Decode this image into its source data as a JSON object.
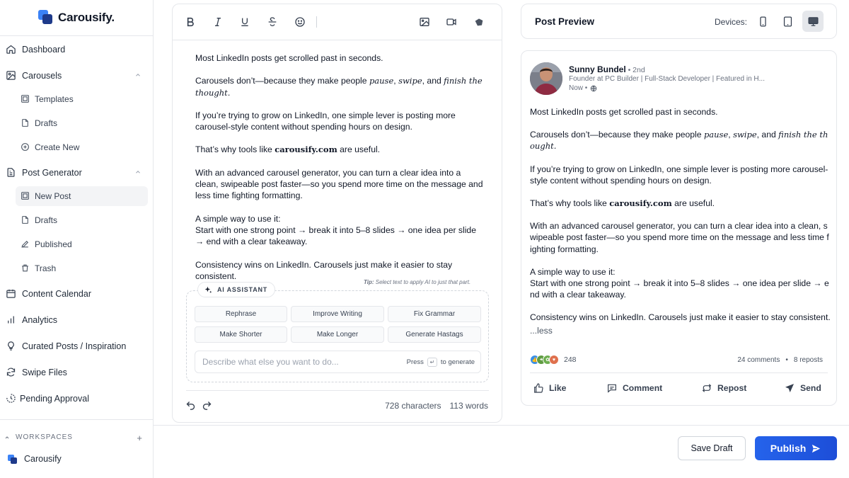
{
  "brand": {
    "name": "Carousify."
  },
  "nav": {
    "dashboard": "Dashboard",
    "carousels": "Carousels",
    "carousels_sub": {
      "templates": "Templates",
      "drafts": "Drafts",
      "create_new": "Create New"
    },
    "post_generator": "Post Generator",
    "post_generator_sub": {
      "new_post": "New Post",
      "drafts": "Drafts",
      "published": "Published",
      "trash": "Trash"
    },
    "content_calendar": "Content Calendar",
    "analytics": "Analytics",
    "curated": "Curated Posts / Inspiration",
    "swipe_files": "Swipe Files",
    "pending_approval": "Pending Approval"
  },
  "workspaces": {
    "heading": "WORKSPACES",
    "add": "+",
    "items": [
      {
        "name": "Carousify"
      }
    ]
  },
  "editor": {
    "toolbar_icons": [
      "bold-icon",
      "italic-icon",
      "underline-icon",
      "strikethrough-icon",
      "emoji-icon",
      "image-icon",
      "video-icon",
      "carousel-icon"
    ],
    "content": {
      "p1": "Most LinkedIn posts get scrolled past in seconds.",
      "p2_a": "Carousels don’t—because they make people ",
      "p2_pause": "pause",
      "p2_b": ", ",
      "p2_swipe": "swipe",
      "p2_c": ", and ",
      "p2_finish": "finish the thought",
      "p2_d": ".",
      "p3": "If you’re trying to grow on LinkedIn, one simple lever is posting more carousel-style content without spending hours on design.",
      "p4_a": "That’s why tools like ",
      "p4_brand": "carousify.com",
      "p4_b": " are useful.",
      "p5": "With an advanced carousel generator, you can turn a clear idea into a clean, swipeable post faster—so you spend more time on the message and less time fighting formatting.",
      "p6_l1": "A simple way to use it:",
      "p6_l2": "Start with one strong point → break it into 5–8 slides → one idea per slide → end with a clear takeaway.",
      "p7": "Consistency wins on LinkedIn. Carousels just make it easier to stay consistent."
    },
    "tip_label": "Tip:",
    "tip_text": " Select text to apply AI to just that part.",
    "ai_badge": "AI ASSISTANT",
    "ai_actions": [
      "Rephrase",
      "Improve Writing",
      "Fix Grammar",
      "Make Shorter",
      "Make Longer",
      "Generate Hastags"
    ],
    "prompt_placeholder": "Describe what else you want to do...",
    "prompt_press": "Press",
    "prompt_key": "↵",
    "prompt_generate": "to generate",
    "characters": "728 characters",
    "words": "113 words"
  },
  "preview": {
    "title": "Post Preview",
    "devices_label": "Devices:",
    "devices": [
      "mobile",
      "tablet",
      "desktop"
    ],
    "active_device": "desktop",
    "author": "Sunny Bundel",
    "degree": " • 2nd",
    "headline": "Founder at PC Builder | Full-Stack Developer | Featured in H...",
    "time": "Now •",
    "content": {
      "p1": "Most LinkedIn posts get scrolled past in seconds.",
      "p3": "If you’re trying to grow on LinkedIn, one simple lever is posting more carousel-style content without spending hours on design.",
      "p5": "With an advanced carousel generator, you can turn a clear idea into a clean, swipeable post faster—so you spend more time on the message and less time fighting formatting.",
      "p6_l1": "A simple way to use it:",
      "p6_l2": "Start with one strong point → break it into 5–8 slides → one idea per slide → end with a clear takeaway.",
      "p7": "Consistency wins on LinkedIn. Carousels just make it easier to stay consistent.",
      "less": "...less"
    },
    "reactions_count": "248",
    "comments": "24 comments",
    "dot": "•",
    "reposts": "8 reposts",
    "actions": {
      "like": "Like",
      "comment": "Comment",
      "repost": "Repost",
      "send": "Send"
    }
  },
  "footer": {
    "save_draft": "Save Draft",
    "publish": "Publish"
  },
  "colors": {
    "accent": "#2563eb",
    "active_bg": "#f3f4f6",
    "border": "#e5e7eb"
  }
}
